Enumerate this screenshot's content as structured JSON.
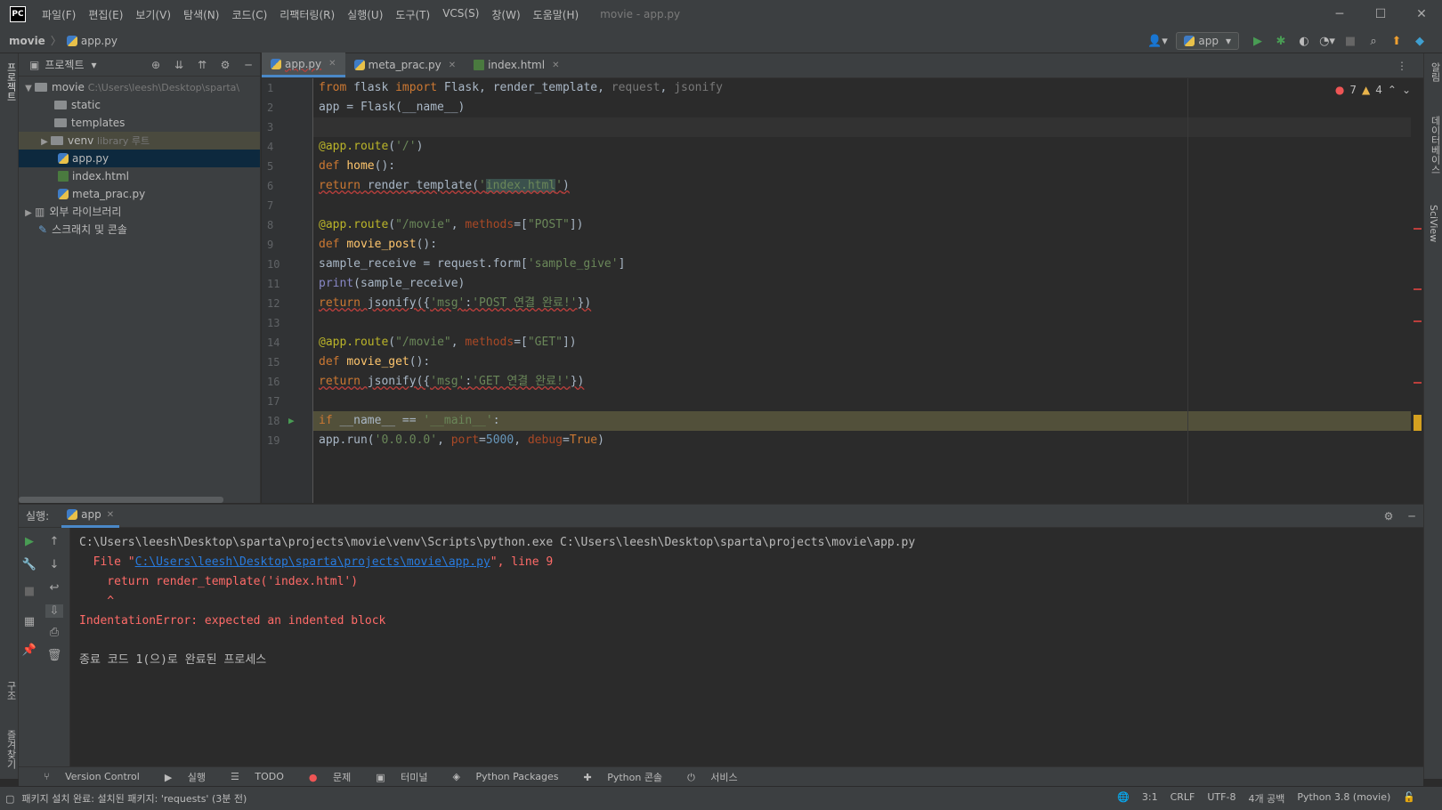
{
  "menu": [
    "파일(F)",
    "편집(E)",
    "보기(V)",
    "탐색(N)",
    "코드(C)",
    "리팩터링(R)",
    "실행(U)",
    "도구(T)",
    "VCS(S)",
    "창(W)",
    "도움말(H)"
  ],
  "window_title": "movie - app.py",
  "breadcrumb": {
    "project": "movie",
    "file": "app.py"
  },
  "run_config": "app",
  "project_panel": {
    "title": "프로젝트",
    "root": {
      "name": "movie",
      "path": "C:\\Users\\leesh\\Desktop\\sparta\\"
    },
    "items": [
      {
        "name": "static"
      },
      {
        "name": "templates"
      },
      {
        "name": "venv",
        "note": "library 루트"
      },
      {
        "name": "app.py"
      },
      {
        "name": "index.html"
      },
      {
        "name": "meta_prac.py"
      }
    ],
    "external": "외부 라이브러리",
    "scratch": "스크래치 및 콘솔"
  },
  "tabs": [
    {
      "label": "app.py"
    },
    {
      "label": "meta_prac.py"
    },
    {
      "label": "index.html"
    }
  ],
  "inspections": {
    "errors": "7",
    "warnings": "4"
  },
  "line_numbers": [
    "1",
    "2",
    "3",
    "4",
    "5",
    "6",
    "7",
    "8",
    "9",
    "10",
    "11",
    "12",
    "13",
    "14",
    "15",
    "16",
    "17",
    "18",
    "19"
  ],
  "run_panel": {
    "label": "실행:",
    "tab": "app",
    "output": {
      "cmd": "C:\\Users\\leesh\\Desktop\\sparta\\projects\\movie\\venv\\Scripts\\python.exe C:\\Users\\leesh\\Desktop\\sparta\\projects\\movie\\app.py",
      "file_prefix": "  File \"",
      "file_link": "C:\\Users\\leesh\\Desktop\\sparta\\projects\\movie\\app.py",
      "file_suffix": "\", line 9",
      "code_line": "    return render_template('index.html')",
      "caret": "    ^",
      "error": "IndentationError: expected an indented block",
      "exit": "종료 코드 1(으)로 완료된 프로세스"
    }
  },
  "left_strip": {
    "project": "프로젝트",
    "structure": "구조",
    "bookmarks": "즐겨찾기"
  },
  "right_strip": {
    "notifications": "알림",
    "database": "데이터베이스",
    "sciview": "SciView"
  },
  "bottom_tabs": [
    "Version Control",
    "실행",
    "TODO",
    "문제",
    "터미널",
    "Python Packages",
    "Python 콘솔",
    "서비스"
  ],
  "status": {
    "message": "패키지 설치 완료: 설치된 패키지: 'requests' (3분 전)",
    "position": "3:1",
    "line_sep": "CRLF",
    "encoding": "UTF-8",
    "indent": "4개 공백",
    "interpreter": "Python 3.8 (movie)"
  },
  "colors": {
    "accent": "#4a88c7",
    "error": "#ff6b68",
    "link": "#287bde"
  }
}
